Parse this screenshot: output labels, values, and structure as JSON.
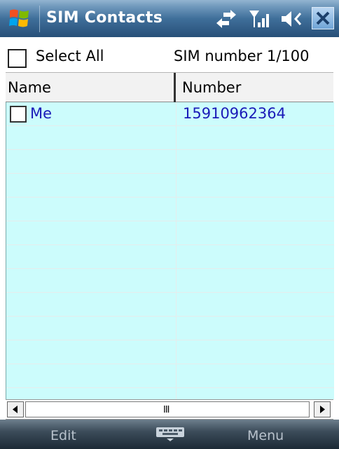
{
  "titlebar": {
    "title": "SIM Contacts",
    "icons": [
      "windows-start-icon",
      "data-sync-icon",
      "signal-strength-icon",
      "volume-icon",
      "close-icon"
    ]
  },
  "select_all": {
    "label": "Select All",
    "checked": false
  },
  "sim_status": "SIM number 1/100",
  "table": {
    "columns": [
      "Name",
      "Number"
    ],
    "rows": [
      {
        "name": "Me",
        "number": "15910962364",
        "checked": false
      }
    ]
  },
  "scrollbar": {
    "grip": "III"
  },
  "softkeys": {
    "left": "Edit",
    "right": "Menu",
    "center_icon": "keyboard-icon"
  },
  "colors": {
    "list_bg": "#ccfcfc",
    "row_text": "#1a1ab8",
    "titlebar": "#3f6f9a"
  }
}
